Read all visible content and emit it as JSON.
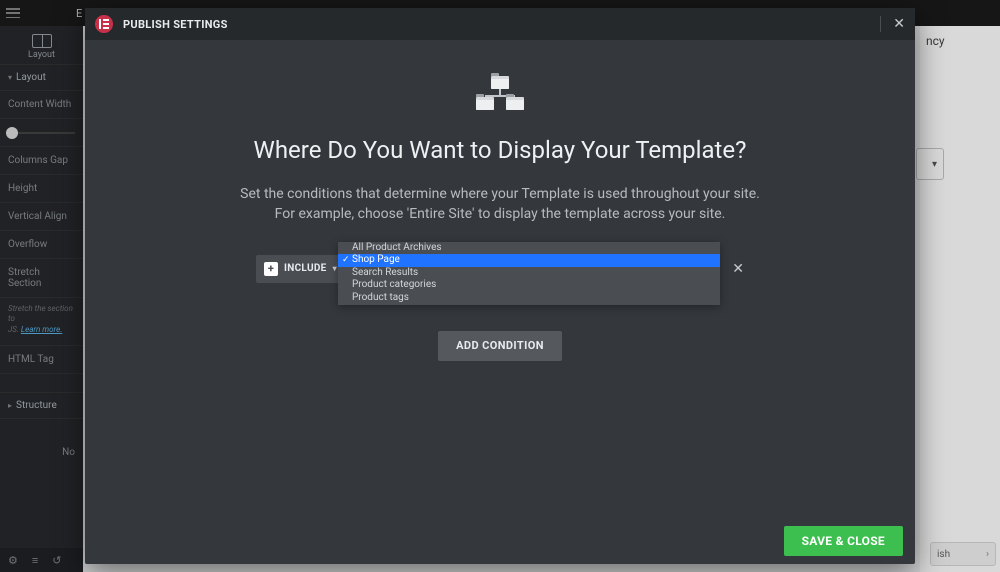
{
  "topbar": {
    "letter": "E"
  },
  "sidebar": {
    "top_label": "Layout",
    "section_layout": "Layout",
    "items": {
      "content_width": "Content Width",
      "columns_gap": "Columns Gap",
      "height": "Height",
      "vertical_align": "Vertical Align",
      "overflow": "Overflow",
      "stretch_section": "Stretch Section",
      "html_tag": "HTML Tag"
    },
    "note_prefix": "Stretch the section to",
    "note_line2": "JS.",
    "learn_more": "Learn more.",
    "section_structure": "Structure",
    "truncated_right": "No"
  },
  "bg": {
    "right_word": "ncy",
    "publish_chip": "ish"
  },
  "modal": {
    "title": "PUBLISH SETTINGS",
    "heading": "Where Do You Want to Display Your Template?",
    "desc1": "Set the conditions that determine where your Template is used throughout your site.",
    "desc2": "For example, choose 'Entire Site' to display the template across your site.",
    "include_label": "INCLUDE",
    "dropdown": [
      "All Product Archives",
      "Shop Page",
      "Search Results",
      "Product categories",
      "Product tags"
    ],
    "add_condition": "ADD CONDITION",
    "save_close": "SAVE & CLOSE"
  }
}
